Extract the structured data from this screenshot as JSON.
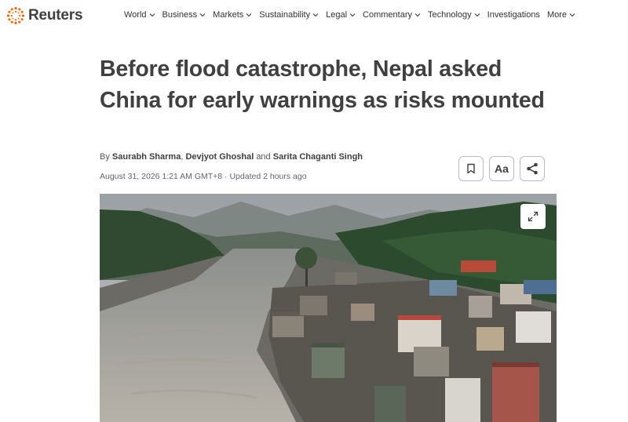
{
  "brand": {
    "name": "Reuters",
    "accent": "#fa6400"
  },
  "nav": {
    "items": [
      {
        "label": "World",
        "has_dropdown": true
      },
      {
        "label": "Business",
        "has_dropdown": true
      },
      {
        "label": "Markets",
        "has_dropdown": true
      },
      {
        "label": "Sustainability",
        "has_dropdown": true
      },
      {
        "label": "Legal",
        "has_dropdown": true
      },
      {
        "label": "Commentary",
        "has_dropdown": true
      },
      {
        "label": "Technology",
        "has_dropdown": true
      },
      {
        "label": "Investigations",
        "has_dropdown": false
      },
      {
        "label": "More",
        "has_dropdown": true
      }
    ]
  },
  "article": {
    "headline": "Before flood catastrophe, Nepal asked China for early warnings as risks mounted",
    "byline_prefix": "By",
    "authors": [
      "Saurabh Sharma",
      "Devjyot Ghoshal",
      "Sarita Chaganti Singh"
    ],
    "byline_sep_1": ",",
    "byline_sep_2": "and",
    "dateline": "August 31, 2026 1:21 AM GMT+8 · Updated 2 hours ago"
  },
  "tools": {
    "bookmark_icon": "bookmark-icon",
    "text_size_label": "Aa",
    "share_icon": "share-icon"
  },
  "photo": {
    "description_icon": "expand-icon"
  }
}
